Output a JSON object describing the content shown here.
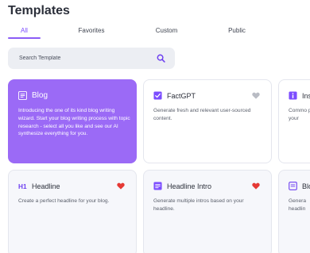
{
  "page": {
    "title": "Templates"
  },
  "tabs": [
    {
      "label": "All",
      "active": true
    },
    {
      "label": "Favorites",
      "active": false
    },
    {
      "label": "Custom",
      "active": false
    },
    {
      "label": "Public",
      "active": false
    }
  ],
  "search": {
    "placeholder": "Search Template"
  },
  "colors": {
    "accent": "#8b5cf6",
    "feature_card": "#9b6af6",
    "heart_red": "#e53935",
    "heart_grey": "#b9bcc4"
  },
  "cards": [
    {
      "title": "Blog",
      "icon": "list-icon",
      "description": "Introducing the one of its kind blog writing wizard. Start your blog writing process with topic research - select all you like and see our AI synthesize everything for you."
    },
    {
      "title": "FactGPT",
      "icon": "checkbox-icon",
      "favorite": false,
      "description": "Generate fresh and relevant user-sourced content."
    },
    {
      "title": "Ins",
      "icon": "info-icon",
      "description": "Commo per your"
    },
    {
      "title": "Headline",
      "icon": "h1-icon",
      "favorite": true,
      "description": "Create a perfect headline for your blog."
    },
    {
      "title": "Headline Intro",
      "icon": "paragraph-icon",
      "favorite": true,
      "description": "Generate multiple intros based on your headline."
    },
    {
      "title": "Blo",
      "icon": "document-icon",
      "description": "Genera headlin"
    }
  ]
}
